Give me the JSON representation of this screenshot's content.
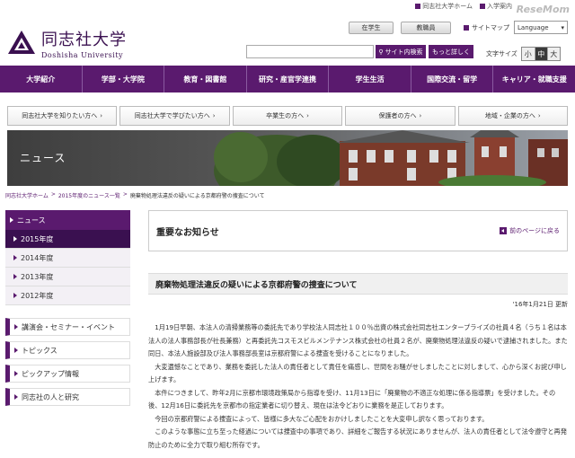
{
  "header": {
    "toplinks": [
      "同志社大学ホーム",
      "入学案内"
    ],
    "watermark": "ReseMom",
    "logo_title": "同志社大学",
    "logo_sub": "Doshisha University",
    "btn_students": "在学生",
    "btn_staff": "教職員",
    "sitemap": "サイトマップ",
    "language": "Language",
    "search_placeholder": "",
    "search_button": "サイト内検索",
    "more_button": "もっと詳しく",
    "fontsize_label": "文字サイズ",
    "fontsize_options": [
      "小",
      "中",
      "大"
    ]
  },
  "gnav": [
    "大学紹介",
    "学部・大学院",
    "教育・図書館",
    "研究・産官学連携",
    "学生生活",
    "国際交流・留学",
    "キャリア・就職支援"
  ],
  "subnav": [
    "同志社大学を知りたい方へ",
    "同志社大学で学びたい方へ",
    "卒業生の方へ",
    "保護者の方へ",
    "地域・企業の方へ"
  ],
  "banner": {
    "label": "ニュース"
  },
  "breadcrumb": {
    "items": [
      "同志社大学ホーム",
      "2015年度のニュース一覧"
    ],
    "current": "廃棄物処理法違反の疑いによる京都府警の捜査について",
    "sep": ">"
  },
  "sidebar": {
    "head": "ニュース",
    "years": [
      "2015年度",
      "2014年度",
      "2013年度",
      "2012年度"
    ],
    "items": [
      "講演会・セミナー・イベント",
      "トピックス",
      "ピックアップ情報",
      "同志社の人と研究"
    ]
  },
  "main": {
    "notice_title": "重要なお知らせ",
    "back_link": "前のページに戻る",
    "article_title": "廃棄物処理法違反の疑いによる京都府警の捜査について",
    "update": "'16年1月21日 更新",
    "paragraphs": [
      "1月19日早朝、本法人の清掃業務等の委託先であり学校法人同志社１００％出資の株式会社同志社エンタープライズの社員４名（うち１名は本法人の法人事務部長が社長兼務）と再委託先コスモスビルメンテナンス株式会社の社員２名が、廃棄物処理法違反の疑いで逮捕されました。また同日、本法人施設部及び法人事務部長室は京都府警による捜査を受けることになりました。",
      "大変遺憾なことであり、業務を委託した法人の責任者として責任を痛感し、世間をお騒がせしましたことに対しまして、心から深くお詫び申し上げます。",
      "本件につきまして、昨年2月に京都市環境政策局から指導を受け、11月13日に「廃棄物の不適正な処理に係る指導票」を受けました。その後、12月16日に委託先を京都市の指定業者に切り替え、現在は法令どおりに業務を是正しております。",
      "今回の京都府警による捜査によって、皆様に多大なご心配をおかけしましたことを大変申し訳なく思っております。",
      "このような事態に立ち至った経過については捜査中の事項であり、詳細をご報告する状況にありませんが、法人の責任者として法令遵守と再発防止のために全力で取り組む所存です。"
    ]
  },
  "colors": {
    "brand": "#5a1a6e",
    "brand_dark": "#3a1050"
  }
}
